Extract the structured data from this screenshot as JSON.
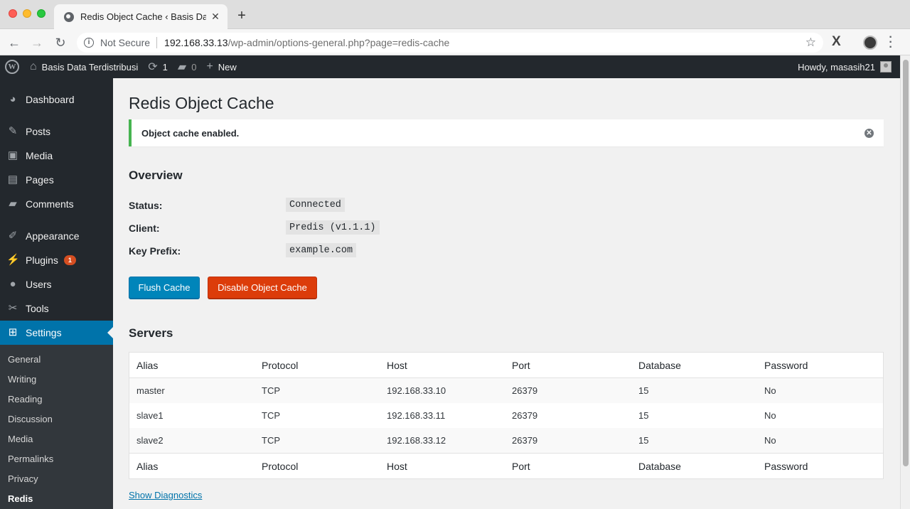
{
  "browser": {
    "tab_title": "Redis Object Cache ‹ Basis Data",
    "security_label": "Not Secure",
    "url_host": "192.168.33.13",
    "url_path": "/wp-admin/options-general.php?page=redis-cache",
    "ext_label": "X"
  },
  "adminbar": {
    "site_name": "Basis Data Terdistribusi",
    "updates_count": "1",
    "comments_count": "0",
    "new_label": "New",
    "howdy": "Howdy, masasih21"
  },
  "sidebar": {
    "items": [
      {
        "label": "Dashboard",
        "icon": "dashboard-icon"
      },
      {
        "label": "Posts",
        "icon": "pin-icon"
      },
      {
        "label": "Media",
        "icon": "media-icon"
      },
      {
        "label": "Pages",
        "icon": "pages-icon"
      },
      {
        "label": "Comments",
        "icon": "comment-icon"
      },
      {
        "label": "Appearance",
        "icon": "brush-icon"
      },
      {
        "label": "Plugins",
        "icon": "plugin-icon",
        "badge": "1"
      },
      {
        "label": "Users",
        "icon": "user-icon"
      },
      {
        "label": "Tools",
        "icon": "wrench-icon"
      },
      {
        "label": "Settings",
        "icon": "settings-icon"
      }
    ],
    "submenu": [
      "General",
      "Writing",
      "Reading",
      "Discussion",
      "Media",
      "Permalinks",
      "Privacy",
      "Redis"
    ]
  },
  "page": {
    "title": "Redis Object Cache",
    "notice": "Object cache enabled.",
    "overview_heading": "Overview",
    "fields": [
      {
        "label": "Status:",
        "value": "Connected"
      },
      {
        "label": "Client:",
        "value": "Predis (v1.1.1)"
      },
      {
        "label": "Key Prefix:",
        "value": "example.com"
      }
    ],
    "flush_button": "Flush Cache",
    "disable_button": "Disable Object Cache",
    "servers_heading": "Servers",
    "diagnostics_link": "Show Diagnostics"
  },
  "servers": {
    "columns": [
      "Alias",
      "Protocol",
      "Host",
      "Port",
      "Database",
      "Password"
    ],
    "rows": [
      [
        "master",
        "TCP",
        "192.168.33.10",
        "26379",
        "15",
        "No"
      ],
      [
        "slave1",
        "TCP",
        "192.168.33.11",
        "26379",
        "15",
        "No"
      ],
      [
        "slave2",
        "TCP",
        "192.168.33.12",
        "26379",
        "15",
        "No"
      ]
    ]
  },
  "colors": {
    "accent": "#0073aa",
    "danger": "#dc3c0a",
    "success": "#46b450",
    "adminbar": "#23282d"
  }
}
